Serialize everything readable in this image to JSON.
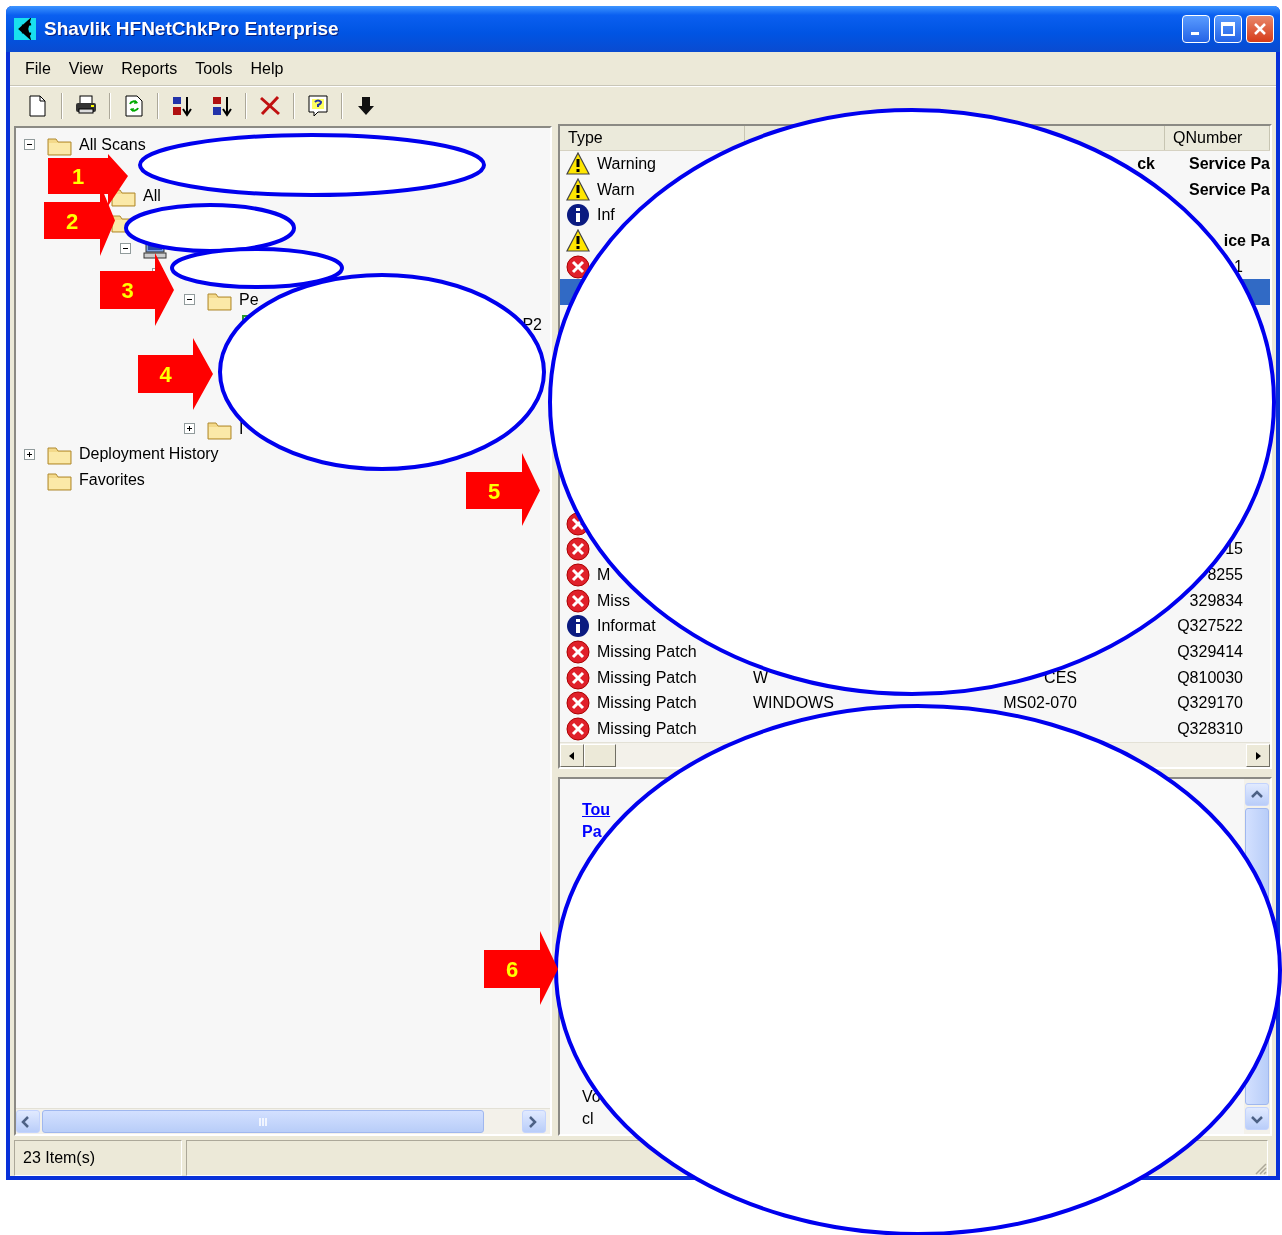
{
  "window": {
    "title": "Shavlik HFNetChkPro Enterprise"
  },
  "menu": [
    "File",
    "View",
    "Reports",
    "Tools",
    "Help"
  ],
  "toolbar": [
    {
      "kind": "new",
      "separator_before": false
    },
    {
      "kind": "print",
      "separator_before": true
    },
    {
      "kind": "refresh",
      "separator_before": true
    },
    {
      "kind": "sort-asc",
      "separator_before": true
    },
    {
      "kind": "sort-desc",
      "separator_before": false
    },
    {
      "kind": "delete",
      "separator_before": true
    },
    {
      "kind": "help",
      "separator_before": true
    },
    {
      "kind": "down",
      "separator_before": true
    }
  ],
  "tree": [
    {
      "label": "All Scans",
      "kind": "folder",
      "expanded": true,
      "children": [
        {
          "children": [
            {
              "label": "All",
              "kind": "folder"
            },
            {
              "kind": "folder",
              "children": [
                {
                  "kind": "computer",
                  "expanded": true,
                  "children": [
                    {
                      "expanded": true,
                      "children": [
                        {
                          "label": "Pe",
                          "kind": "folder",
                          "expanded": true,
                          "children": [
                            {
                              "label_tail": "P2",
                              "kind": "item"
                            }
                          ]
                        },
                        {
                          "label": "I",
                          "kind": "folder",
                          "expanded": false
                        }
                      ]
                    }
                  ]
                }
              ]
            }
          ]
        }
      ]
    },
    {
      "label": "Deployment History",
      "kind": "folder",
      "expanded": false
    },
    {
      "label": "Favorites",
      "kind": "folder"
    }
  ],
  "list": {
    "columns": [
      {
        "label": "Type"
      },
      {},
      {},
      {
        "label": "QNumber"
      }
    ],
    "rows_top": [
      {
        "kind": "warning",
        "type": "Warning",
        "column_3": "ck",
        "qnumber": "Service Pa",
        "bold": true,
        "selected": false
      },
      {
        "kind": "warning",
        "type": "Warn",
        "qnumber": "Service Pa",
        "bold": true,
        "selected": false
      },
      {
        "kind": "info",
        "type": "Inf",
        "selected": false
      },
      {
        "kind": "warning",
        "qnumber": "ice Pa",
        "bold": true,
        "selected": false
      },
      {
        "kind": "error",
        "qnumber": "1",
        "selected": false
      },
      {
        "selected": true
      }
    ],
    "rows_bottom": [
      {
        "kind": "error",
        "selected": false
      },
      {
        "kind": "error",
        "qnumber": "15",
        "selected": false
      },
      {
        "kind": "error",
        "type": "M",
        "qnumber": "8255",
        "selected": false
      },
      {
        "kind": "error",
        "type": "Miss",
        "qnumber": "329834",
        "selected": false
      },
      {
        "kind": "info",
        "type": "Informat",
        "qnumber": "Q327522",
        "selected": false
      },
      {
        "kind": "error",
        "type": "Missing Patch",
        "qnumber": "Q329414",
        "selected": false
      },
      {
        "kind": "error",
        "type": "Missing Patch",
        "column_2": "W",
        "column_3": "CES",
        "qnumber": "Q810030",
        "selected": false
      },
      {
        "kind": "error",
        "type": "Missing Patch",
        "column_2": "WINDOWS",
        "column_3": "MS02-070",
        "qnumber": "Q329170",
        "selected": false
      },
      {
        "kind": "error",
        "type": "Missing Patch",
        "qnumber": "Q328310",
        "selected": false
      }
    ]
  },
  "details": {
    "top_lines": [
      {
        "kind": "link",
        "text": "Tou"
      },
      {
        "kind": "heading",
        "text": "Pa"
      }
    ],
    "bottom_lines": [
      {
        "kind": "text",
        "text": "Vo"
      },
      {
        "kind": "text",
        "text": "cl"
      }
    ]
  },
  "status_bar": {
    "panels": [
      "23 Item(s)"
    ]
  },
  "annotations": [
    {
      "number": "1"
    },
    {
      "number": "2"
    },
    {
      "number": "3"
    },
    {
      "number": "4"
    },
    {
      "number": "5"
    },
    {
      "number": "6"
    }
  ]
}
